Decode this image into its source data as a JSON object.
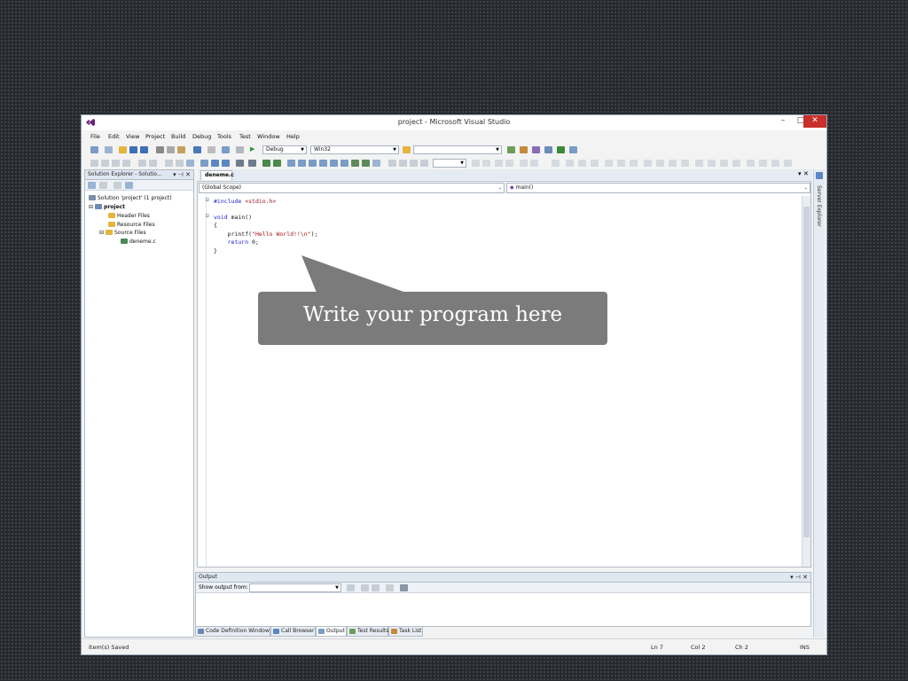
{
  "window": {
    "title": "project - Microsoft Visual Studio",
    "controls": {
      "minimize": "–",
      "maximize": "□",
      "close": "✕"
    }
  },
  "menu": [
    "File",
    "Edit",
    "View",
    "Project",
    "Build",
    "Debug",
    "Tools",
    "Test",
    "Window",
    "Help"
  ],
  "toolbar": {
    "config": "Debug",
    "platform": "Win32",
    "play_glyph": "▶"
  },
  "solution_explorer": {
    "title": "Solution Explorer - Solutio...",
    "controls": "▾ ⊣ ✕",
    "solution": "Solution 'project' (1 project)",
    "project": "project",
    "header_files": "Header Files",
    "resource_files": "Resource Files",
    "source_files": "Source Files",
    "file": "deneme.c"
  },
  "editor": {
    "tab": "deneme.c",
    "tab_close": "▾ ✕",
    "scope": "(Global Scope)",
    "member": "main()",
    "code": {
      "include_kw": "#include",
      "include_hdr": " <stdio.h>",
      "void_kw": "void",
      "main_sig": " main()",
      "open_brace": "{",
      "printf_call": "printf(",
      "printf_str": "\"Hello World!!\\n\"",
      "printf_end": ");",
      "return_kw": "return",
      "return_val": " 0;",
      "close_brace": "}"
    }
  },
  "output": {
    "title": "Output",
    "controls": "▾ ⊣ ✕",
    "show_label": "Show output from:"
  },
  "bottom_tabs": [
    "Code Definition Window",
    "Call Browser",
    "Output",
    "Test Results",
    "Task List"
  ],
  "server_explorer": "Server Explorer",
  "status": {
    "message": "Item(s) Saved",
    "ln": "Ln 7",
    "col": "Col 2",
    "ch": "Ch 2",
    "mode": "INS"
  },
  "callout": "Write your program here",
  "colors": {
    "accent_close": "#c9302c",
    "callout_bg": "#7b7b7b",
    "keyword": "#1b1bd6",
    "string": "#a31515"
  }
}
